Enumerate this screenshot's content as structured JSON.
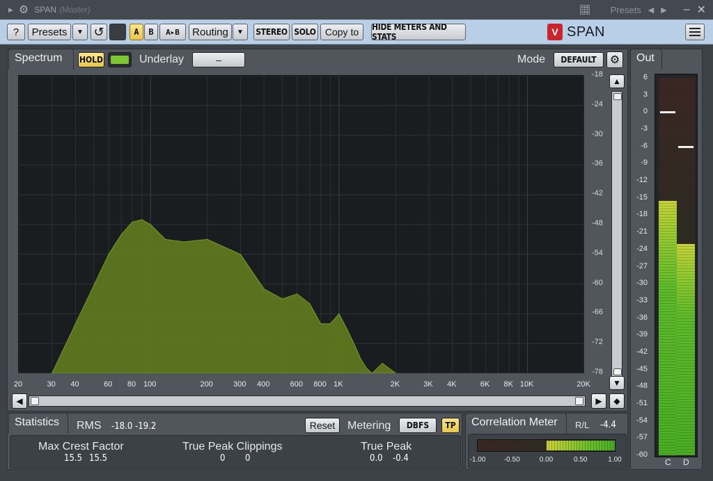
{
  "titlebar": {
    "title": "SPAN",
    "subtitle": "(Master)",
    "presets_label": "Presets",
    "nav_prev": "◀",
    "nav_next": "▶",
    "minimize": "–",
    "close": "✕"
  },
  "toolbar": {
    "help": "?",
    "presets": "Presets",
    "dropdown": "▼",
    "undo": "↺",
    "a": "A",
    "b": "B",
    "a_to_b": "A▸B",
    "routing": "Routing",
    "stereo": "STEREO",
    "solo": "SOLO",
    "copy_to": "Copy to",
    "hide_meters": "HIDE METERS AND STATS",
    "logo_badge": "V",
    "logo_text": "SPAN"
  },
  "spectrum": {
    "tab": "Spectrum",
    "hold": "HOLD",
    "underlay_label": "Underlay",
    "underlay_value": "–",
    "mode_label": "Mode",
    "mode_value": "DEFAULT",
    "y_labels": [
      "-18",
      "-24",
      "-30",
      "-36",
      "-42",
      "-48",
      "-54",
      "-60",
      "-66",
      "-72",
      "-78"
    ],
    "x_labels": [
      "20",
      "30",
      "40",
      "60",
      "80",
      "100",
      "200",
      "300",
      "400",
      "600",
      "800",
      "1K",
      "2K",
      "3K",
      "4K",
      "6K",
      "8K",
      "10K",
      "20K"
    ],
    "scroll_up": "▲",
    "scroll_down": "▼",
    "scroll_left": "◀",
    "scroll_right": "▶",
    "scroll_reset": "◆"
  },
  "chart_data": {
    "type": "area",
    "xscale": "log",
    "x_unit": "Hz",
    "xlim": [
      20,
      20000
    ],
    "ylim": [
      -78,
      -18
    ],
    "x": [
      30,
      40,
      60,
      70,
      80,
      90,
      100,
      120,
      150,
      200,
      300,
      400,
      500,
      600,
      700,
      800,
      900,
      1000,
      1100,
      1200,
      1300,
      1400,
      1500,
      1700,
      2000
    ],
    "y": [
      -78,
      -68,
      -54,
      -50,
      -47.5,
      -47,
      -48,
      -51,
      -51.5,
      -51,
      -54,
      -61,
      -63,
      -62,
      -64,
      -68,
      -68,
      -66,
      -69,
      -72,
      -75,
      -77,
      -78,
      -76,
      -78
    ],
    "fill_color": "#5f7a1e",
    "grid": true
  },
  "out": {
    "tab": "Out",
    "labels": [
      "6",
      "3",
      "0",
      "-3",
      "-6",
      "-9",
      "-12",
      "-15",
      "-18",
      "-21",
      "-24",
      "-27",
      "-30",
      "-33",
      "-36",
      "-39",
      "-42",
      "-45",
      "-48",
      "-51",
      "-54",
      "-57",
      "-60"
    ],
    "scale_top_db": 6,
    "scale_bottom_db": -60,
    "channels": [
      {
        "name": "C",
        "level_db": -15.5,
        "peak_db": 0
      },
      {
        "name": "D",
        "level_db": -23,
        "peak_db": -6
      }
    ]
  },
  "statistics": {
    "tab": "Statistics",
    "rms_label": "RMS",
    "rms_left": "-18.0",
    "rms_right": "-19.2",
    "reset": "Reset",
    "metering_label": "Metering",
    "metering_value": "DBFS",
    "tp": "TP",
    "crest_label": "Max Crest Factor",
    "crest_left": "15.5",
    "crest_right": "15.5",
    "clip_label": "True Peak Clippings",
    "clip_left": "0",
    "clip_right": "0",
    "tpeak_label": "True Peak",
    "tpeak_left": "0.0",
    "tpeak_right": "-0.4"
  },
  "correlation": {
    "tab": "Correlation Meter",
    "rl_label": "R/L",
    "rl_value": "-4.4",
    "labels": [
      "-1.00",
      "-0.50",
      "0.00",
      "0.50",
      "1.00"
    ],
    "range_from": 0.0,
    "range_to": 1.0
  },
  "colors": {
    "toolbar_bg": "#b9cee7",
    "accent_yellow": "#f3d65f",
    "spectrum_fill": "#5f7a1e",
    "meter_green": "#5dbb2a"
  }
}
